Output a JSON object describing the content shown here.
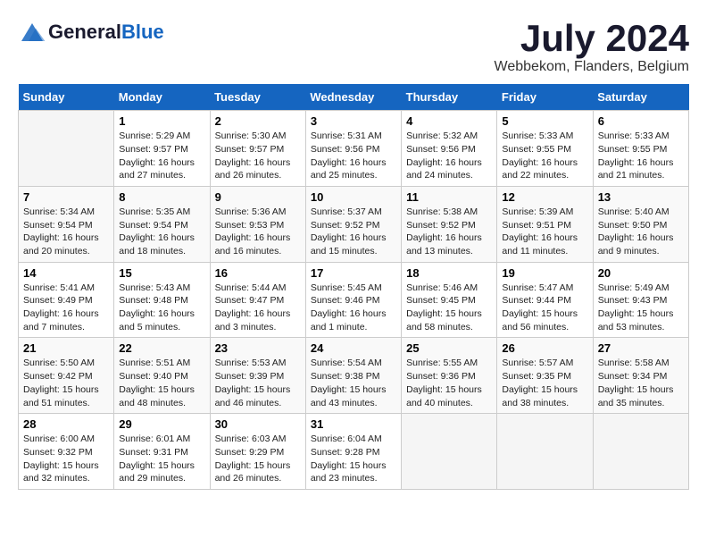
{
  "header": {
    "logo_general": "General",
    "logo_blue": "Blue",
    "month_title": "July 2024",
    "subtitle": "Webbekom, Flanders, Belgium"
  },
  "days_header": [
    "Sunday",
    "Monday",
    "Tuesday",
    "Wednesday",
    "Thursday",
    "Friday",
    "Saturday"
  ],
  "weeks": [
    [
      {
        "day": "",
        "info": ""
      },
      {
        "day": "1",
        "info": "Sunrise: 5:29 AM\nSunset: 9:57 PM\nDaylight: 16 hours and 27 minutes."
      },
      {
        "day": "2",
        "info": "Sunrise: 5:30 AM\nSunset: 9:57 PM\nDaylight: 16 hours and 26 minutes."
      },
      {
        "day": "3",
        "info": "Sunrise: 5:31 AM\nSunset: 9:56 PM\nDaylight: 16 hours and 25 minutes."
      },
      {
        "day": "4",
        "info": "Sunrise: 5:32 AM\nSunset: 9:56 PM\nDaylight: 16 hours and 24 minutes."
      },
      {
        "day": "5",
        "info": "Sunrise: 5:33 AM\nSunset: 9:55 PM\nDaylight: 16 hours and 22 minutes."
      },
      {
        "day": "6",
        "info": "Sunrise: 5:33 AM\nSunset: 9:55 PM\nDaylight: 16 hours and 21 minutes."
      }
    ],
    [
      {
        "day": "7",
        "info": "Sunrise: 5:34 AM\nSunset: 9:54 PM\nDaylight: 16 hours and 20 minutes."
      },
      {
        "day": "8",
        "info": "Sunrise: 5:35 AM\nSunset: 9:54 PM\nDaylight: 16 hours and 18 minutes."
      },
      {
        "day": "9",
        "info": "Sunrise: 5:36 AM\nSunset: 9:53 PM\nDaylight: 16 hours and 16 minutes."
      },
      {
        "day": "10",
        "info": "Sunrise: 5:37 AM\nSunset: 9:52 PM\nDaylight: 16 hours and 15 minutes."
      },
      {
        "day": "11",
        "info": "Sunrise: 5:38 AM\nSunset: 9:52 PM\nDaylight: 16 hours and 13 minutes."
      },
      {
        "day": "12",
        "info": "Sunrise: 5:39 AM\nSunset: 9:51 PM\nDaylight: 16 hours and 11 minutes."
      },
      {
        "day": "13",
        "info": "Sunrise: 5:40 AM\nSunset: 9:50 PM\nDaylight: 16 hours and 9 minutes."
      }
    ],
    [
      {
        "day": "14",
        "info": "Sunrise: 5:41 AM\nSunset: 9:49 PM\nDaylight: 16 hours and 7 minutes."
      },
      {
        "day": "15",
        "info": "Sunrise: 5:43 AM\nSunset: 9:48 PM\nDaylight: 16 hours and 5 minutes."
      },
      {
        "day": "16",
        "info": "Sunrise: 5:44 AM\nSunset: 9:47 PM\nDaylight: 16 hours and 3 minutes."
      },
      {
        "day": "17",
        "info": "Sunrise: 5:45 AM\nSunset: 9:46 PM\nDaylight: 16 hours and 1 minute."
      },
      {
        "day": "18",
        "info": "Sunrise: 5:46 AM\nSunset: 9:45 PM\nDaylight: 15 hours and 58 minutes."
      },
      {
        "day": "19",
        "info": "Sunrise: 5:47 AM\nSunset: 9:44 PM\nDaylight: 15 hours and 56 minutes."
      },
      {
        "day": "20",
        "info": "Sunrise: 5:49 AM\nSunset: 9:43 PM\nDaylight: 15 hours and 53 minutes."
      }
    ],
    [
      {
        "day": "21",
        "info": "Sunrise: 5:50 AM\nSunset: 9:42 PM\nDaylight: 15 hours and 51 minutes."
      },
      {
        "day": "22",
        "info": "Sunrise: 5:51 AM\nSunset: 9:40 PM\nDaylight: 15 hours and 48 minutes."
      },
      {
        "day": "23",
        "info": "Sunrise: 5:53 AM\nSunset: 9:39 PM\nDaylight: 15 hours and 46 minutes."
      },
      {
        "day": "24",
        "info": "Sunrise: 5:54 AM\nSunset: 9:38 PM\nDaylight: 15 hours and 43 minutes."
      },
      {
        "day": "25",
        "info": "Sunrise: 5:55 AM\nSunset: 9:36 PM\nDaylight: 15 hours and 40 minutes."
      },
      {
        "day": "26",
        "info": "Sunrise: 5:57 AM\nSunset: 9:35 PM\nDaylight: 15 hours and 38 minutes."
      },
      {
        "day": "27",
        "info": "Sunrise: 5:58 AM\nSunset: 9:34 PM\nDaylight: 15 hours and 35 minutes."
      }
    ],
    [
      {
        "day": "28",
        "info": "Sunrise: 6:00 AM\nSunset: 9:32 PM\nDaylight: 15 hours and 32 minutes."
      },
      {
        "day": "29",
        "info": "Sunrise: 6:01 AM\nSunset: 9:31 PM\nDaylight: 15 hours and 29 minutes."
      },
      {
        "day": "30",
        "info": "Sunrise: 6:03 AM\nSunset: 9:29 PM\nDaylight: 15 hours and 26 minutes."
      },
      {
        "day": "31",
        "info": "Sunrise: 6:04 AM\nSunset: 9:28 PM\nDaylight: 15 hours and 23 minutes."
      },
      {
        "day": "",
        "info": ""
      },
      {
        "day": "",
        "info": ""
      },
      {
        "day": "",
        "info": ""
      }
    ]
  ]
}
